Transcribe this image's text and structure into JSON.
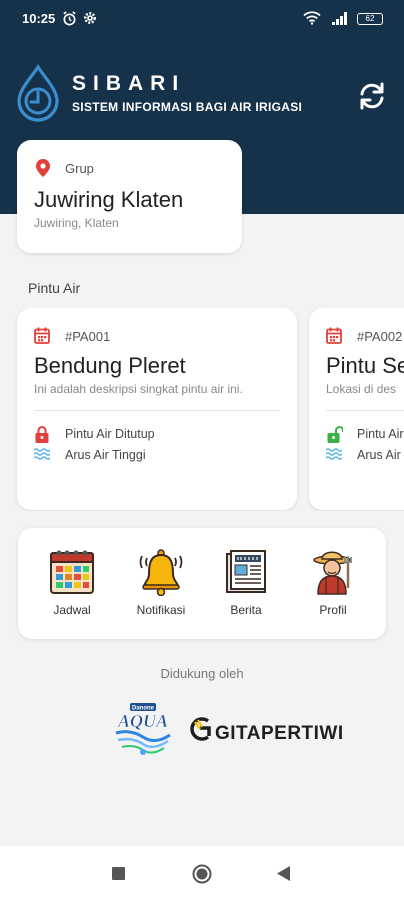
{
  "status_bar": {
    "time": "10:25",
    "battery": "62",
    "icons": [
      "alarm-icon",
      "gear-icon",
      "wifi-icon",
      "signal-icon",
      "battery-icon"
    ]
  },
  "header": {
    "title": "SIBARI",
    "subtitle": "SISTEM INFORMASI BAGI AIR IRIGASI",
    "background_color": "#15324a",
    "logo_icon": "water-drop-clock-icon",
    "refresh_icon": "refresh-icon"
  },
  "group": {
    "label": "Grup",
    "name": "Juwiring Klaten",
    "location": "Juwiring, Klaten",
    "icon": "location-pin-icon"
  },
  "section": {
    "gates_title": "Pintu Air"
  },
  "gates": [
    {
      "code": "#PA001",
      "name": "Bendung Pleret",
      "description": "Ini adalah deskripsi singkat pintu air ini.",
      "status": "Pintu Air Ditutup",
      "status_icon": "lock-closed-icon",
      "status_color": "#e0403a",
      "flow": "Arus Air Tinggi"
    },
    {
      "code": "#PA002",
      "name": "Pintu Se",
      "description": "Lokasi di des",
      "status": "Pintu Air",
      "status_icon": "lock-open-icon",
      "status_color": "#3cb043",
      "flow": "Arus Air"
    }
  ],
  "menu": [
    {
      "label": "Jadwal",
      "icon": "calendar-icon"
    },
    {
      "label": "Notifikasi",
      "icon": "bell-icon"
    },
    {
      "label": "Berita",
      "icon": "newspaper-icon"
    },
    {
      "label": "Profil",
      "icon": "farmer-icon"
    }
  ],
  "sponsors": {
    "title": "Didukung oleh",
    "aqua": "AQUA",
    "aqua_badge": "Danone",
    "gita": "GITAPERTIWI"
  },
  "navigation": {
    "buttons": [
      "recents-square-icon",
      "home-circle-icon",
      "back-triangle-icon"
    ]
  }
}
